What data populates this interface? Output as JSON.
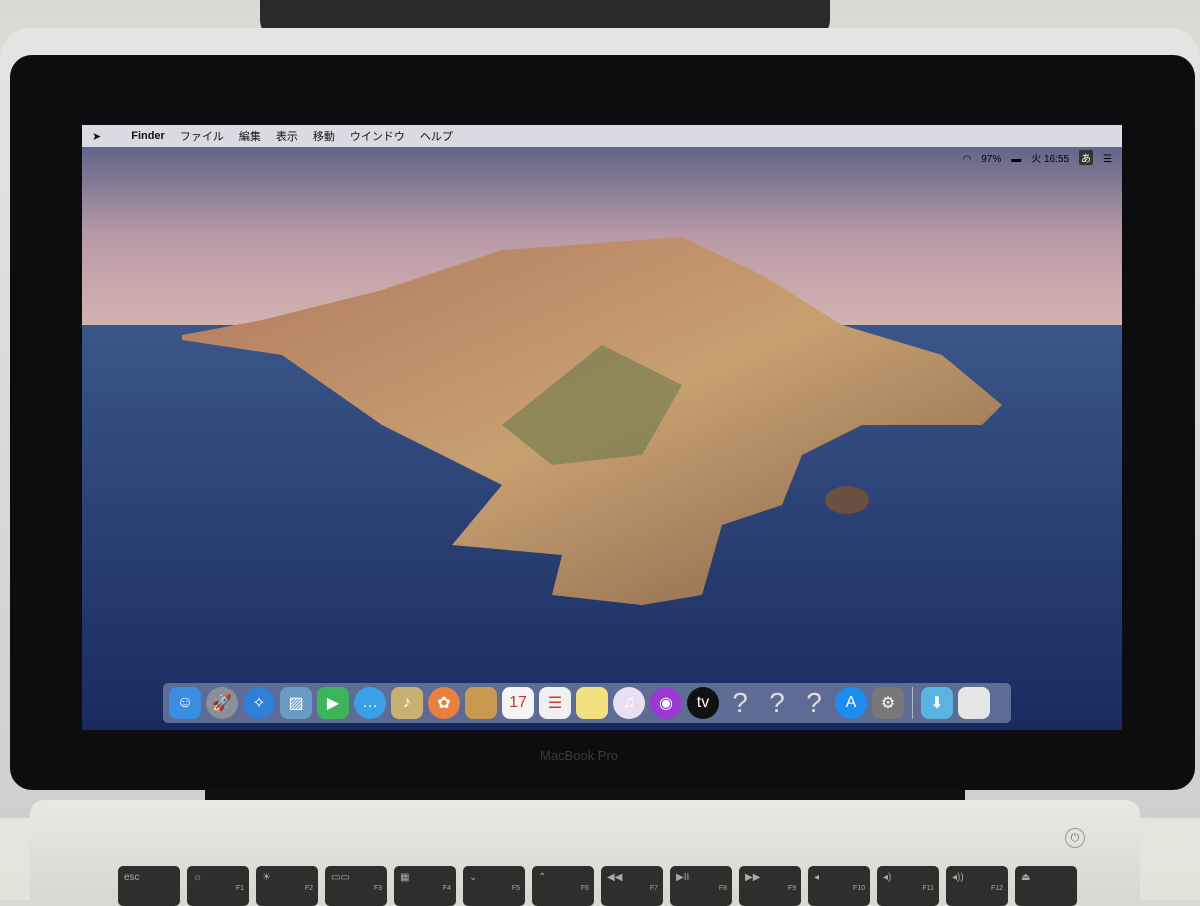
{
  "menubar": {
    "apple": "",
    "app": "Finder",
    "items": [
      "ファイル",
      "編集",
      "表示",
      "移動",
      "ウインドウ",
      "ヘルプ"
    ]
  },
  "status": {
    "battery": "97%",
    "clock": "火 16:55",
    "ime": "あ"
  },
  "dock": {
    "items": [
      {
        "name": "finder",
        "glyph": "☺",
        "color": "#3a8de0"
      },
      {
        "name": "launchpad",
        "glyph": "🚀",
        "color": "#8a8f98"
      },
      {
        "name": "safari",
        "glyph": "✧",
        "color": "#2f7fd8"
      },
      {
        "name": "preview",
        "glyph": "▨",
        "color": "#6a9bc4"
      },
      {
        "name": "facetime",
        "glyph": "▶",
        "color": "#3cb55a"
      },
      {
        "name": "messages",
        "glyph": "…",
        "color": "#3aa0e8"
      },
      {
        "name": "contacts",
        "glyph": "♪",
        "color": "#c8b070"
      },
      {
        "name": "photos",
        "glyph": "✿",
        "color": "#e88040"
      },
      {
        "name": "notes-book",
        "glyph": "",
        "color": "#c89a50"
      },
      {
        "name": "calendar",
        "glyph": "17",
        "color": "#f4f4f4"
      },
      {
        "name": "reminders",
        "glyph": "☰",
        "color": "#f0f0f0"
      },
      {
        "name": "notes",
        "glyph": "",
        "color": "#f0e080"
      },
      {
        "name": "music",
        "glyph": "♫",
        "color": "#e8e0f0"
      },
      {
        "name": "podcasts",
        "glyph": "◉",
        "color": "#9a3ad0"
      },
      {
        "name": "apple-tv",
        "glyph": "tv",
        "color": "#111"
      },
      {
        "name": "unknown-1",
        "glyph": "?",
        "color": ""
      },
      {
        "name": "unknown-2",
        "glyph": "?",
        "color": ""
      },
      {
        "name": "unknown-3",
        "glyph": "?",
        "color": ""
      },
      {
        "name": "app-store",
        "glyph": "A",
        "color": "#1d8cf0"
      },
      {
        "name": "system-preferences",
        "glyph": "⚙",
        "color": "#777"
      }
    ],
    "right": [
      {
        "name": "downloads-folder",
        "glyph": "⬇",
        "color": "#5ab4e0"
      },
      {
        "name": "trash",
        "glyph": "",
        "color": "#e6e6e6"
      }
    ]
  },
  "device": {
    "logo": "MacBook Pro"
  },
  "keyboard": [
    {
      "k": "esc",
      "f": ""
    },
    {
      "k": "☼",
      "f": "F1"
    },
    {
      "k": "☀",
      "f": "F2"
    },
    {
      "k": "▭▭",
      "f": "F3"
    },
    {
      "k": "▦",
      "f": "F4"
    },
    {
      "k": "⌄",
      "f": "F5"
    },
    {
      "k": "⌃",
      "f": "F6"
    },
    {
      "k": "◀◀",
      "f": "F7"
    },
    {
      "k": "▶II",
      "f": "F8"
    },
    {
      "k": "▶▶",
      "f": "F9"
    },
    {
      "k": "◂",
      "f": "F10"
    },
    {
      "k": "◂)",
      "f": "F11"
    },
    {
      "k": "◂))",
      "f": "F12"
    },
    {
      "k": "⏏",
      "f": ""
    }
  ]
}
